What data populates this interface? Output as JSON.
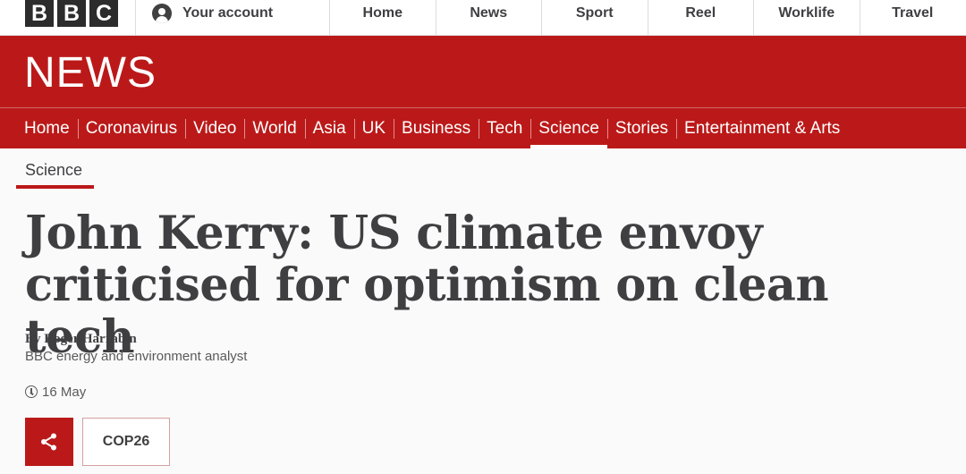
{
  "masthead": {
    "logo": [
      "B",
      "B",
      "C"
    ],
    "account_label": "Your account",
    "nav": [
      "Home",
      "News",
      "Sport",
      "Reel",
      "Worklife",
      "Travel"
    ]
  },
  "banner": {
    "title": "NEWS"
  },
  "section_nav": {
    "items": [
      "Home",
      "Coronavirus",
      "Video",
      "World",
      "Asia",
      "UK",
      "Business",
      "Tech",
      "Science",
      "Stories",
      "Entertainment & Arts"
    ],
    "active": "Science"
  },
  "article": {
    "section": "Science",
    "headline": "John Kerry: US climate envoy criticised for optimism on clean tech",
    "byline": "By Roger Harrabin",
    "author_role": "BBC energy and environment analyst",
    "date": "16 May",
    "tag": "COP26"
  },
  "colors": {
    "brand_red": "#bb1919",
    "text": "#3f3f42"
  },
  "icons": {
    "account": "account-icon",
    "clock": "clock-icon",
    "share": "share-icon"
  }
}
